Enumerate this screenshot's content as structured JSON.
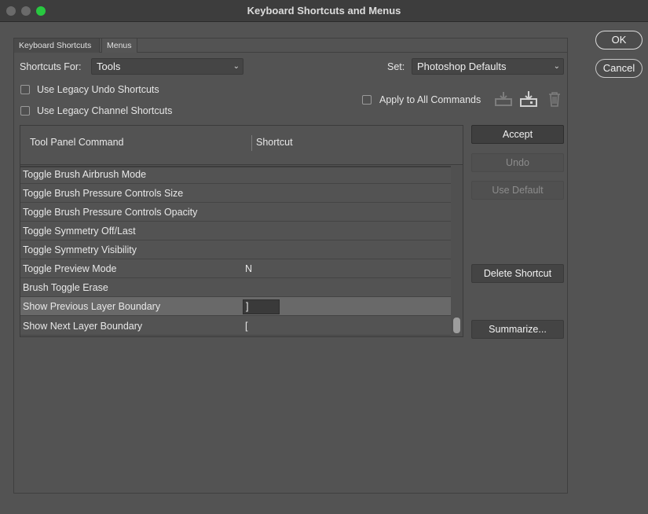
{
  "window": {
    "title": "Keyboard Shortcuts and Menus"
  },
  "tabs": [
    {
      "label": "Keyboard Shortcuts",
      "active": true
    },
    {
      "label": "Menus",
      "active": false
    }
  ],
  "shortcuts_for": {
    "label": "Shortcuts For:",
    "value": "Tools"
  },
  "set": {
    "label": "Set:",
    "value": "Photoshop Defaults"
  },
  "options": {
    "legacy_undo": {
      "label": "Use Legacy Undo Shortcuts",
      "checked": false
    },
    "legacy_channel": {
      "label": "Use Legacy Channel Shortcuts",
      "checked": false
    },
    "apply_all": {
      "label": "Apply to All Commands",
      "checked": false
    }
  },
  "set_icons": [
    "save-set-icon",
    "save-as-set-icon",
    "trash-icon"
  ],
  "table": {
    "headers": {
      "command": "Tool Panel Command",
      "shortcut": "Shortcut"
    },
    "rows": [
      {
        "command": "Toggle Brush Airbrush Mode",
        "shortcut": ""
      },
      {
        "command": "Toggle Brush Pressure Controls Size",
        "shortcut": ""
      },
      {
        "command": "Toggle Brush Pressure Controls Opacity",
        "shortcut": ""
      },
      {
        "command": "Toggle Symmetry Off/Last",
        "shortcut": ""
      },
      {
        "command": "Toggle Symmetry Visibility",
        "shortcut": ""
      },
      {
        "command": "Toggle Preview Mode",
        "shortcut": "N"
      },
      {
        "command": "Brush Toggle Erase",
        "shortcut": ""
      },
      {
        "command": "Show Previous Layer Boundary",
        "shortcut": "]",
        "selected": true
      },
      {
        "command": "Show Next Layer Boundary",
        "shortcut": "["
      }
    ]
  },
  "actions": {
    "accept": "Accept",
    "undo": "Undo",
    "use_default": "Use Default",
    "delete_shortcut": "Delete Shortcut",
    "summarize": "Summarize..."
  },
  "dialog": {
    "ok": "OK",
    "cancel": "Cancel"
  },
  "colors": {
    "background": "#535353",
    "titlebar": "#3d3d3d",
    "selected_row": "#696969",
    "zoom_button": "#28c840"
  }
}
